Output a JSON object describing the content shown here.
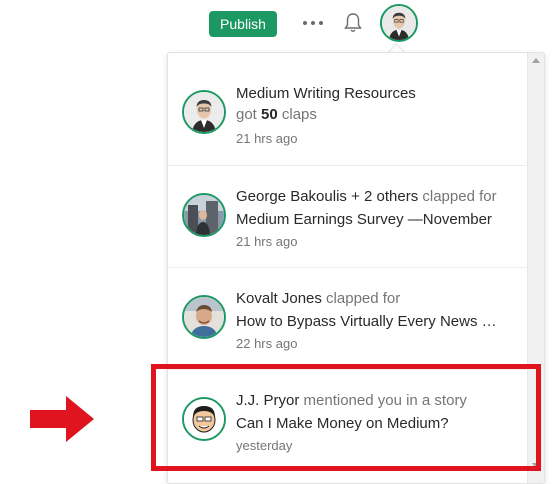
{
  "header": {
    "publish_label": "Publish",
    "more_icon": "more-dots-icon",
    "bell_icon": "bell-icon"
  },
  "colors": {
    "accent": "#1c9963",
    "highlight": "#e0141e"
  },
  "notifications": [
    {
      "actor": "Medium Writing Resources",
      "action_prefix": "got ",
      "count": "50",
      "action_suffix": " claps",
      "title": "",
      "time": "21 hrs ago"
    },
    {
      "actor": "George Bakoulis + 2 others",
      "action": " clapped for",
      "title": "Medium Earnings Survey —November",
      "time": "21 hrs ago"
    },
    {
      "actor": "Kovalt Jones",
      "action": " clapped for",
      "title": "How to Bypass Virtually Every News Paywall",
      "time": "22 hrs ago"
    },
    {
      "actor": "J.J. Pryor",
      "action": " mentioned you in a story",
      "title": "Can I Make Money on Medium?",
      "time": "yesterday"
    }
  ]
}
